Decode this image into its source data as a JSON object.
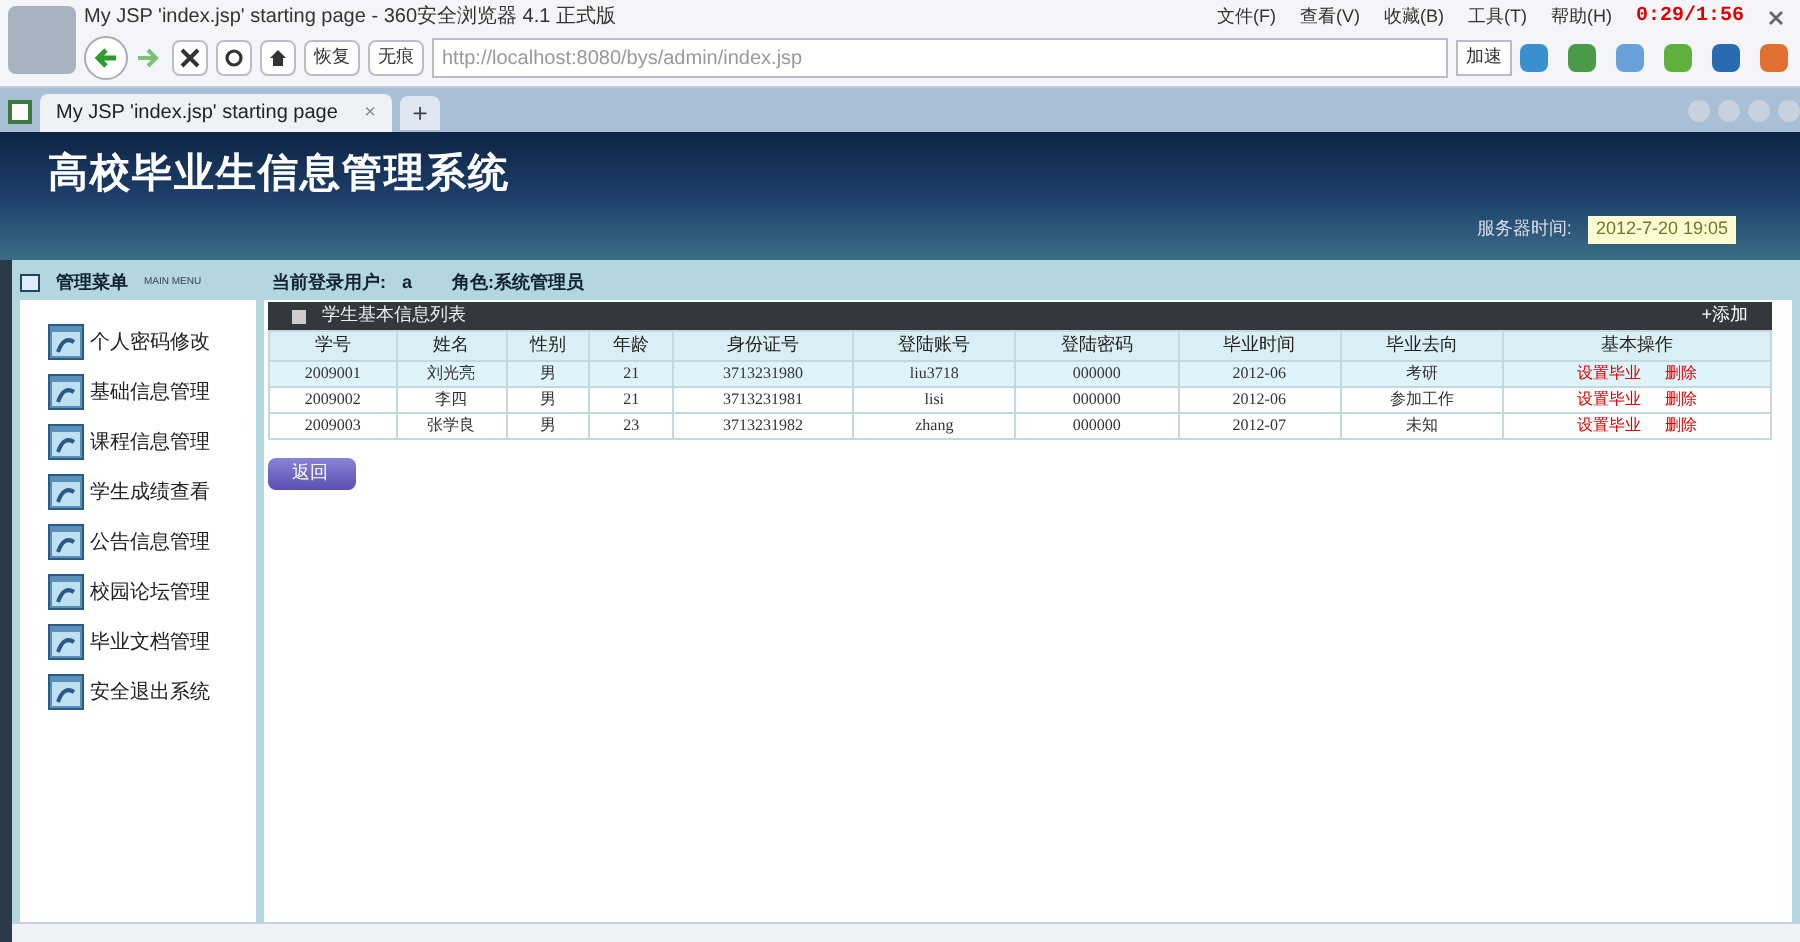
{
  "browser": {
    "title": "My JSP 'index.jsp' starting page - 360安全浏览器 4.1 正式版",
    "menu": [
      "文件(F)",
      "查看(V)",
      "收藏(B)",
      "工具(T)",
      "帮助(H)"
    ],
    "recorder_time": "0:29/1:56",
    "buttons": [
      "恢复",
      "无痕"
    ],
    "url": "http://localhost:8080/bys/admin/index.jsp",
    "accelerate": "加速",
    "tab": {
      "title": "My JSP 'index.jsp' starting page",
      "close": "×"
    },
    "new_tab": "+"
  },
  "header": {
    "title": "高校毕业生信息管理系统",
    "server_time_label": "服务器时间:",
    "server_time": "2012-7-20 19:05"
  },
  "menu_header": {
    "title": "管理菜单",
    "subtitle": "MAIN MENU"
  },
  "user_bar": {
    "user_label": "当前登录用户:",
    "user": "a",
    "role_label": "角色:",
    "role": "系统管理员"
  },
  "sidebar": {
    "items": [
      {
        "label": "个人密码修改"
      },
      {
        "label": "基础信息管理"
      },
      {
        "label": "课程信息管理"
      },
      {
        "label": "学生成绩查看"
      },
      {
        "label": "公告信息管理"
      },
      {
        "label": "校园论坛管理"
      },
      {
        "label": "毕业文档管理"
      },
      {
        "label": "安全退出系统"
      }
    ]
  },
  "table": {
    "title": "学生基本信息列表",
    "add": "+添加",
    "columns": [
      "学号",
      "姓名",
      "性别",
      "年龄",
      "身份证号",
      "登陆账号",
      "登陆密码",
      "毕业时间",
      "毕业去向",
      "基本操作"
    ],
    "rows": [
      {
        "selected": true,
        "cells": [
          "2009001",
          "刘光亮",
          "男",
          "21",
          "3713231980",
          "liu3718",
          "000000",
          "2012-06",
          "考研"
        ],
        "actions": [
          "设置毕业",
          "删除"
        ]
      },
      {
        "selected": false,
        "cells": [
          "2009002",
          "李四",
          "男",
          "21",
          "3713231981",
          "lisi",
          "000000",
          "2012-06",
          "参加工作"
        ],
        "actions": [
          "设置毕业",
          "删除"
        ]
      },
      {
        "selected": false,
        "cells": [
          "2009003",
          "张学良",
          "男",
          "23",
          "3713231982",
          "zhang",
          "000000",
          "2012-07",
          "未知"
        ],
        "actions": [
          "设置毕业",
          "删除"
        ]
      }
    ]
  },
  "back_button": "返回"
}
